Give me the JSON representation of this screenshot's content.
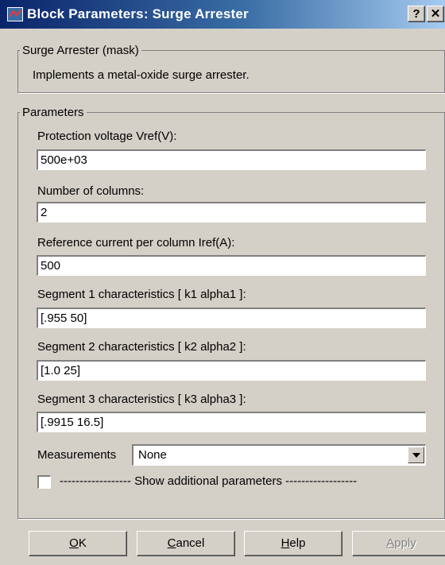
{
  "window": {
    "title": "Block Parameters: Surge Arrester",
    "help_glyph": "?",
    "close_glyph": "✕"
  },
  "mask_group": {
    "legend": "Surge Arrester (mask)",
    "description": "Implements a metal-oxide surge arrester."
  },
  "params_group": {
    "legend": "Parameters",
    "fields": [
      {
        "label": "Protection voltage  Vref(V):",
        "value": "500e+03"
      },
      {
        "label": "Number of columns:",
        "value": "2"
      },
      {
        "label": "Reference current per column Iref(A):",
        "value": "500"
      },
      {
        "label": "Segment 1 characteristics [ k1 alpha1 ]:",
        "value": "[.955 50]"
      },
      {
        "label": "Segment 2 characteristics [ k2 alpha2 ]:",
        "value": "[1.0 25]"
      },
      {
        "label": "Segment 3 characteristics [ k3 alpha3 ]:",
        "value": "[.9915 16.5]"
      }
    ],
    "measurements": {
      "label": "Measurements",
      "selected": "None"
    },
    "show_additional": {
      "label": "------------------ Show additional parameters ------------------",
      "checked": false
    }
  },
  "buttons": {
    "ok": {
      "accel": "O",
      "rest": "K"
    },
    "cancel": {
      "accel": "C",
      "rest": "ancel"
    },
    "help": {
      "accel": "H",
      "rest": "elp"
    },
    "apply": {
      "accel": "A",
      "rest": "pply"
    }
  }
}
